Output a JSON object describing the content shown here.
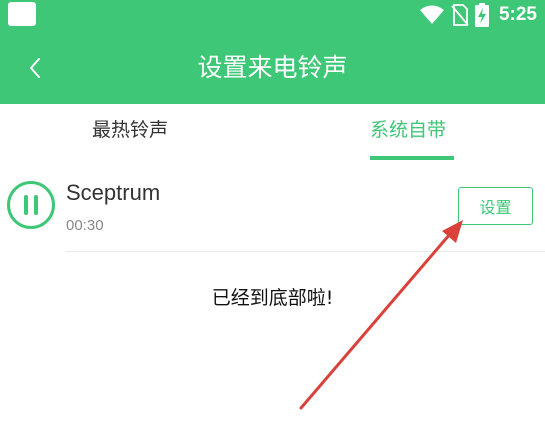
{
  "status_bar": {
    "time": "5:25",
    "icons": [
      "wifi-icon",
      "no-sim-icon",
      "battery-charging-icon"
    ]
  },
  "header": {
    "title": "设置来电铃声",
    "back_icon": "chevron-left-icon"
  },
  "tabs": [
    {
      "label": "最热铃声",
      "active": false
    },
    {
      "label": "系统自带",
      "active": true
    }
  ],
  "ringtones": [
    {
      "name": "Sceptrum",
      "duration": "00:30",
      "state_icon": "pause-icon",
      "action_label": "设置"
    }
  ],
  "list_end_message": "已经到底部啦!",
  "annotation": {
    "type": "arrow",
    "color": "#d9413a",
    "points_to": "设置"
  },
  "colors": {
    "accent": "#3ec777",
    "annotation_arrow": "#d9413a"
  }
}
